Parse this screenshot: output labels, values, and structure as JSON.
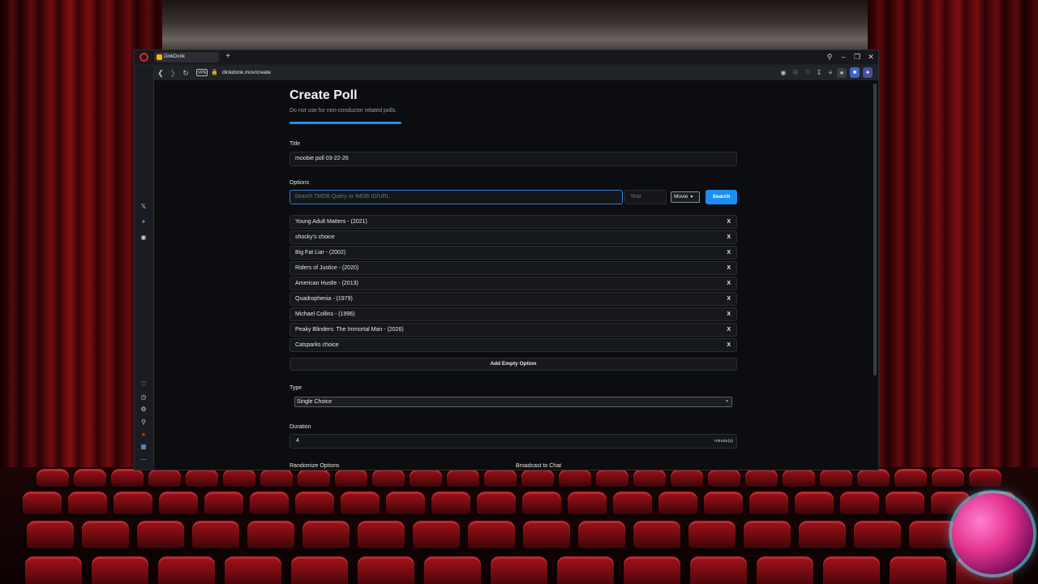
{
  "browser": {
    "tab_title": "DinkDonk",
    "new_tab": "+",
    "vpn_badge": "VPN",
    "url": "dinkdonk.mov/create"
  },
  "page": {
    "title": "Create Poll",
    "subtitle": "Do not use for non-conductor related polls.",
    "progress": 0.25,
    "title_label": "Title",
    "title_value": "moobie poll 03-22-26",
    "options_label": "Options",
    "search_placeholder": "Search TMDB Query or IMDB ID/URL",
    "year_placeholder": "Year",
    "media_type": "Movie",
    "search_button": "Search",
    "options": [
      {
        "label": "Young Adult Matters - (2021)",
        "remove": "X"
      },
      {
        "label": "shocky's choice",
        "remove": "X"
      },
      {
        "label": "Big Fat Liar - (2002)",
        "remove": "X"
      },
      {
        "label": "Riders of Justice - (2020)",
        "remove": "X"
      },
      {
        "label": "American Hustle - (2013)",
        "remove": "X"
      },
      {
        "label": "Quadrophenia - (1979)",
        "remove": "X"
      },
      {
        "label": "Michael Collins - (1996)",
        "remove": "X"
      },
      {
        "label": "Peaky Blinders: The Immortal Man - (2026)",
        "remove": "X"
      },
      {
        "label": "Catsparks choice",
        "remove": "X"
      }
    ],
    "add_empty_option": "Add Empty Option",
    "type_label": "Type",
    "type_value": "Single Choice",
    "duration_label": "Duration",
    "duration_value": "4",
    "duration_unit": "minute(s)",
    "randomize_label": "Randomize Options",
    "broadcast_label": "Broadcast to Chat"
  },
  "colors": {
    "accent": "#1c8ef2",
    "page_bg": "#0c0d10",
    "curtain": "#6e0a0f"
  }
}
